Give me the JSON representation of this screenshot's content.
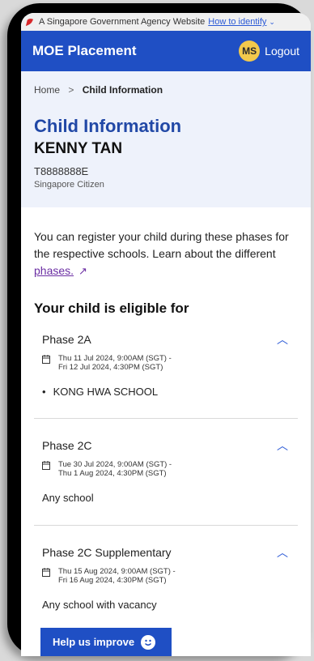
{
  "masthead": {
    "text": "A Singapore Government Agency Website",
    "link": "How to identify",
    "caret": "⌄"
  },
  "navbar": {
    "brand": "MOE Placement",
    "avatar": "MS",
    "logout": "Logout"
  },
  "breadcrumb": {
    "home": "Home",
    "separator": ">",
    "current": "Child Information"
  },
  "child": {
    "heading": "Child Information",
    "name": "KENNY TAN",
    "id": "T8888888E",
    "status": "Singapore Citizen"
  },
  "intro": {
    "text": "You can register your child during these phases for the respective schools. Learn about the different",
    "link": "phases.",
    "link_icon": "↗"
  },
  "eligibility": {
    "heading": "Your child is eligible for",
    "phases": [
      {
        "title": "Phase 2A",
        "date_from": "Thu 11 Jul 2024, 9:00AM (SGT) -",
        "date_to": "Fri 12 Jul 2024, 4:30PM (SGT)",
        "school": "KONG HWA SCHOOL",
        "bullet": "•"
      },
      {
        "title": "Phase 2C",
        "date_from": "Tue 30 Jul 2024, 9:00AM (SGT) -",
        "date_to": "Thu 1 Aug 2024, 4:30PM (SGT)",
        "school": "Any school"
      },
      {
        "title": "Phase 2C Supplementary",
        "date_from": "Thu 15 Aug 2024, 9:00AM (SGT) -",
        "date_to": "Fri 16 Aug 2024, 4:30PM (SGT)",
        "school": "Any school with vacancy"
      }
    ]
  },
  "feedback": {
    "label": "Help us improve"
  },
  "icons": {
    "collapse": "chevron-up-icon",
    "calendar": "calendar-icon",
    "flag": "lion-head-icon"
  },
  "colors": {
    "brand_blue": "#1f4fc4",
    "title_blue": "#2148a6",
    "hero_bg": "#eef2fb",
    "link_purple": "#6b2ea3",
    "avatar_yellow": "#f2c94c"
  }
}
